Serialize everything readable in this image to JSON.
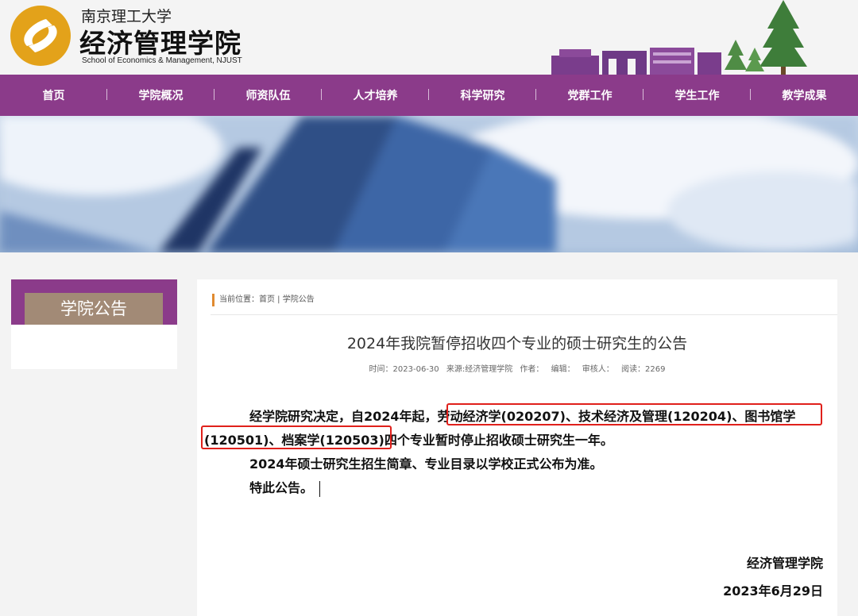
{
  "header": {
    "university": "南京理工大学",
    "school": "经济管理学院",
    "school_en": "School of Economics & Management, NJUST"
  },
  "nav": {
    "items": [
      {
        "label": "首页"
      },
      {
        "label": "学院概况"
      },
      {
        "label": "师资队伍"
      },
      {
        "label": "人才培养"
      },
      {
        "label": "科学研究"
      },
      {
        "label": "党群工作"
      },
      {
        "label": "学生工作"
      },
      {
        "label": "教学成果"
      }
    ]
  },
  "sidebar": {
    "title": "学院公告"
  },
  "breadcrumb": {
    "text": "当前位置：首页 | 学院公告"
  },
  "article": {
    "title": "2024年我院暂停招收四个专业的硕士研究生的公告",
    "meta": {
      "time": "时间：2023-06-30",
      "source": "来源:经济管理学院",
      "author": "作者：",
      "editor": "编辑：",
      "reviewer": "审核人：",
      "views": "阅读：2269"
    },
    "line1": "经学院研究决定，自2024年起，劳动经济学(020207)、技术经济及管理(120204)、图书馆学",
    "line2": "(120501)、档案学(120503)四个专业暂时停止招收硕士研究生一年。",
    "line3": "2024年硕士研究生招生简章、专业目录以学校正式公布为准。",
    "line4": "特此公告。",
    "signature": "经济管理学院",
    "date": "2023年6月29日"
  },
  "colors": {
    "purple": "#8b3b8a",
    "highlight": "#e0201b",
    "sidebar_tab": "#a28a76"
  }
}
